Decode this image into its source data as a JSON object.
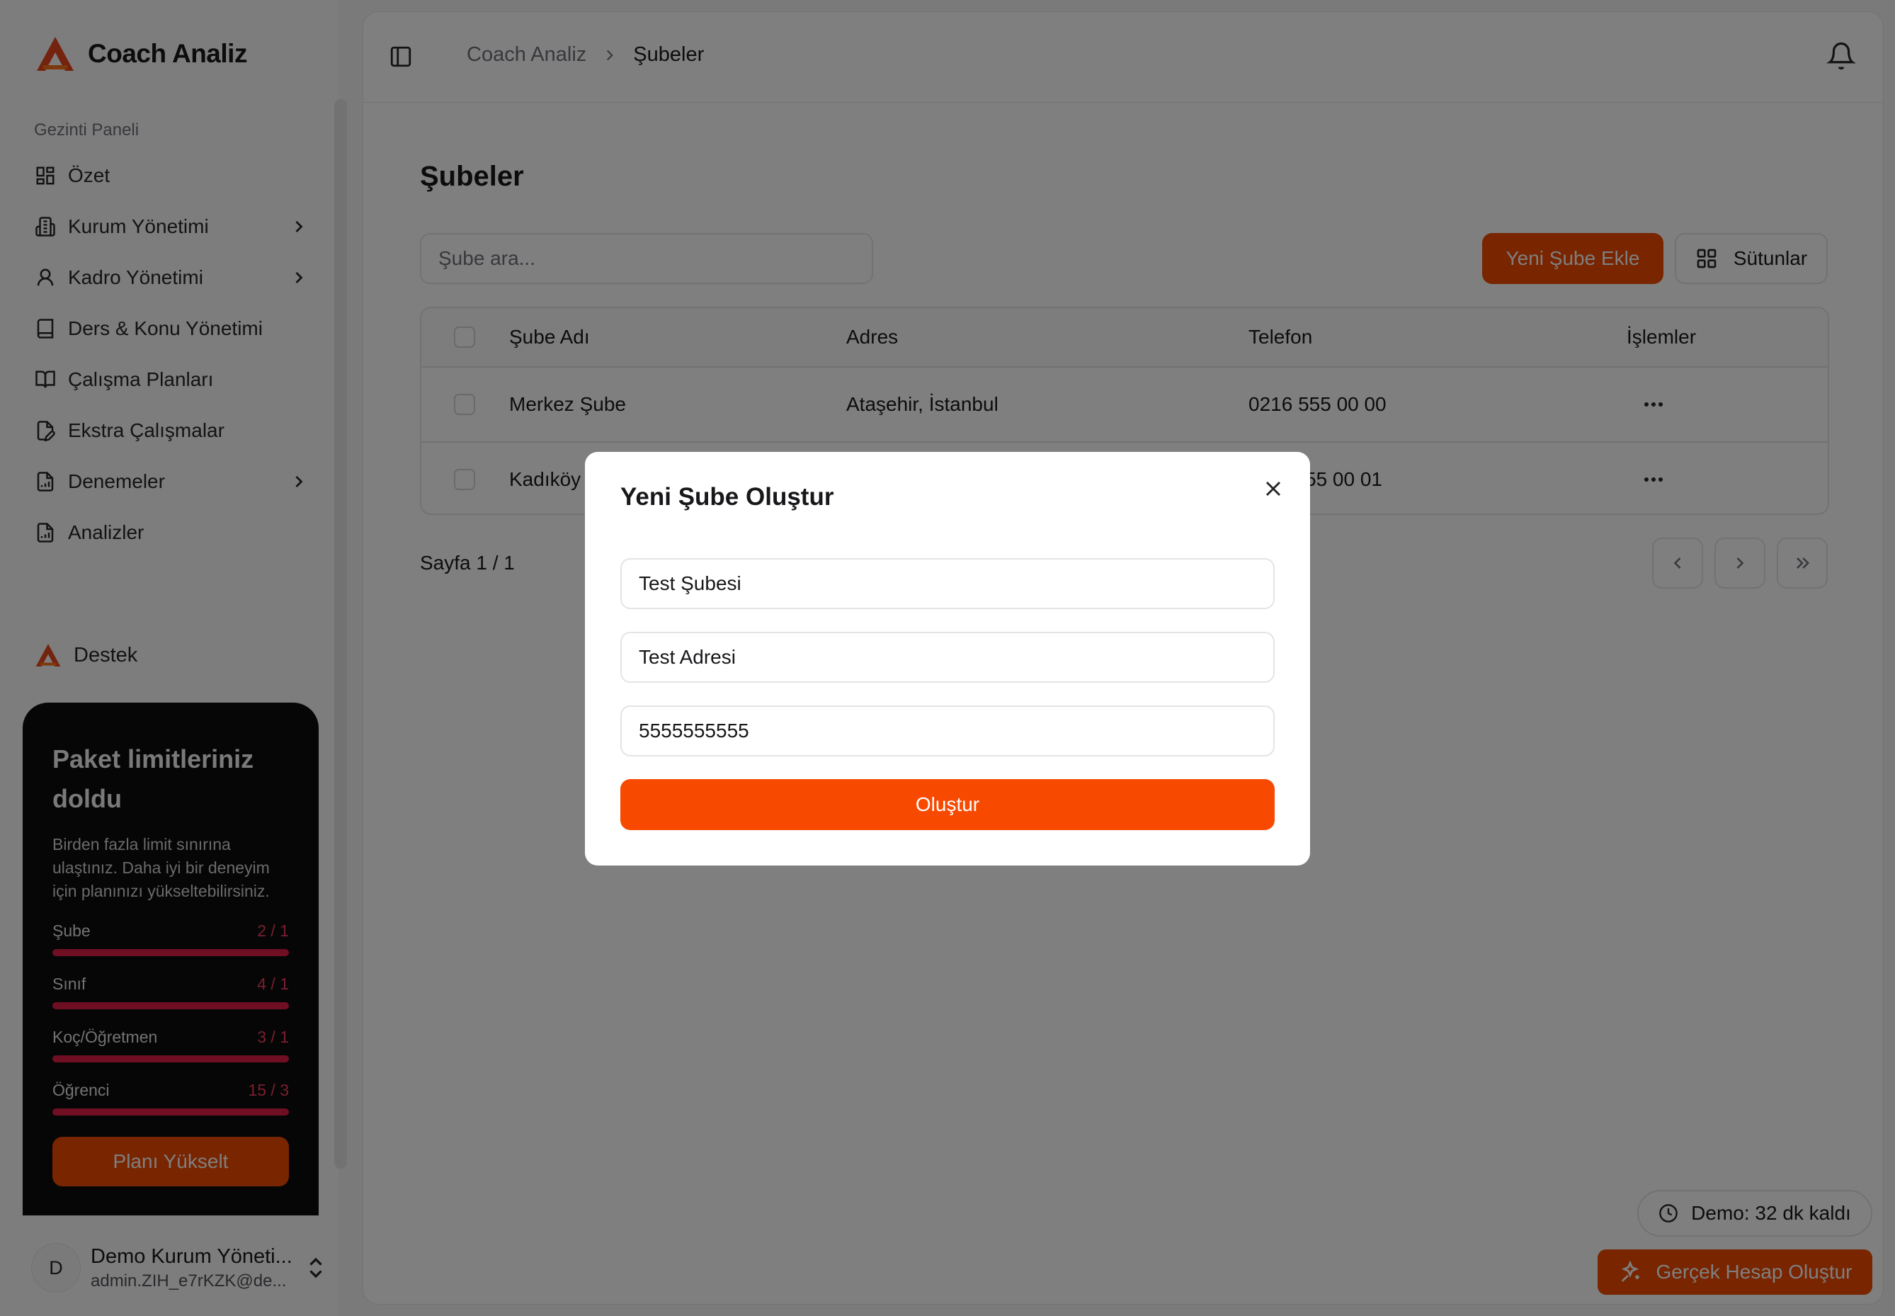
{
  "app": {
    "name": "Coach Analiz",
    "accent": "#f04a00"
  },
  "sidebar": {
    "nav_title": "Gezinti Paneli",
    "items": [
      {
        "label": "Özet",
        "icon": "dashboard-grid-icon",
        "has_children": false
      },
      {
        "label": "Kurum Yönetimi",
        "icon": "building-icon",
        "has_children": true
      },
      {
        "label": "Kadro Yönetimi",
        "icon": "user-icon",
        "has_children": true
      },
      {
        "label": "Ders & Konu Yönetimi",
        "icon": "book-icon",
        "has_children": false
      },
      {
        "label": "Çalışma Planları",
        "icon": "open-book-icon",
        "has_children": false
      },
      {
        "label": "Ekstra Çalışmalar",
        "icon": "file-pen-icon",
        "has_children": false
      },
      {
        "label": "Denemeler",
        "icon": "file-chart-icon",
        "has_children": true
      },
      {
        "label": "Analizler",
        "icon": "file-chart-icon",
        "has_children": false
      }
    ],
    "support": "Destek",
    "limits_card": {
      "title": "Paket limitleriniz doldu",
      "description": "Birden fazla limit sınırına ulaştınız. Daha iyi bir deneyim için planınızı yükseltebilirsiniz.",
      "limits": [
        {
          "name": "Şube",
          "value": "2 / 1"
        },
        {
          "name": "Sınıf",
          "value": "4 / 1"
        },
        {
          "name": "Koç/Öğretmen",
          "value": "3 / 1"
        },
        {
          "name": "Öğrenci",
          "value": "15 / 3"
        }
      ],
      "button": "Planı Yükselt"
    },
    "user": {
      "initial": "D",
      "name": "Demo Kurum Yöneti...",
      "email": "admin.ZIH_e7rKZK@de..."
    }
  },
  "header": {
    "breadcrumb_root": "Coach Analiz",
    "breadcrumb_current": "Şubeler"
  },
  "main": {
    "title": "Şubeler",
    "search_placeholder": "Şube ara...",
    "new_button": "Yeni Şube Ekle",
    "columns_button": "Sütunlar",
    "table": {
      "headers": [
        "Şube Adı",
        "Adres",
        "Telefon",
        "İşlemler"
      ],
      "rows": [
        {
          "name": "Merkez Şube",
          "address": "Ataşehir, İstanbul",
          "phone": "0216 555 00 00"
        },
        {
          "name": "Kadıköy",
          "address": "",
          "phone": "55 00 01"
        }
      ]
    },
    "pagination": "Sayfa 1 / 1"
  },
  "floating": {
    "demo_timer": "Demo: 32 dk kaldı",
    "real_account": "Gerçek Hesap Oluştur"
  },
  "modal": {
    "title": "Yeni Şube Oluştur",
    "name_value": "Test Şubesi",
    "address_value": "Test Adresi",
    "phone_value": "5555555555",
    "submit": "Oluştur"
  }
}
